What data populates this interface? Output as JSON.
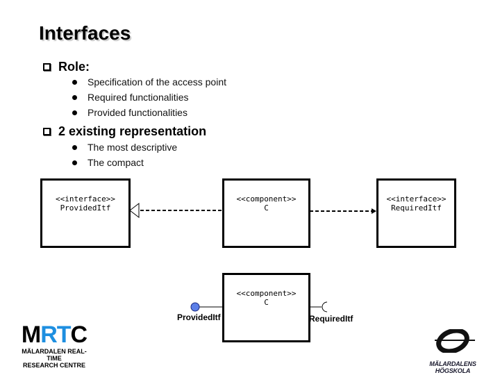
{
  "slide": {
    "title": "Interfaces",
    "sections": [
      {
        "heading": "Role:",
        "bullets": [
          "Specification of the access point",
          "Required functionalities",
          "Provided functionalities"
        ]
      },
      {
        "heading": "2 existing representation",
        "bullets": [
          "The most descriptive",
          "The compact"
        ]
      }
    ]
  },
  "diagram": {
    "descriptive": {
      "provided_box": {
        "stereotype": "<<interface>>",
        "name": "ProvidedItf"
      },
      "component_box": {
        "stereotype": "<<component>>",
        "name": "C"
      },
      "required_box": {
        "stereotype": "<<interface>>",
        "name": "RequiredItf"
      }
    },
    "compact": {
      "component_box": {
        "stereotype": "<<component>>",
        "name": "C"
      },
      "provided_label": "ProvidedItf",
      "required_label": "RequiredItf"
    },
    "colors": {
      "provided_lollipop": "#5b7fe8",
      "line": "#000000"
    }
  },
  "logos": {
    "mrtc": {
      "letters": [
        "M",
        "RT",
        "C"
      ],
      "line1": "MÄLARDALEN REAL-TIME",
      "line2": "RESEARCH CENTRE",
      "accent": "#1e8fe0"
    },
    "mdh": {
      "name": "MÄLARDALENS HÖGSKOLA"
    }
  }
}
